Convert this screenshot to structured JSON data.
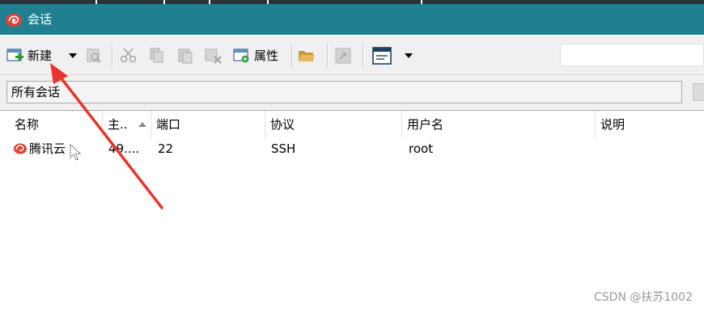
{
  "window": {
    "title": "会话"
  },
  "toolbar": {
    "new_label": "新建",
    "properties_label": "属性"
  },
  "filter": {
    "label": "所有会话"
  },
  "table": {
    "columns": [
      "名称",
      "主..",
      "端口",
      "协议",
      "用户名",
      "说明"
    ],
    "rows": [
      {
        "name": "腾讯云",
        "host": "49....",
        "port": "22",
        "protocol": "SSH",
        "user": "root",
        "desc": ""
      }
    ]
  },
  "watermark": "CSDN @扶苏1002",
  "colors": {
    "titlebar": "#208092",
    "annotation_arrow": "#e8352b",
    "toolbar_bg": "#f0f0f0"
  }
}
